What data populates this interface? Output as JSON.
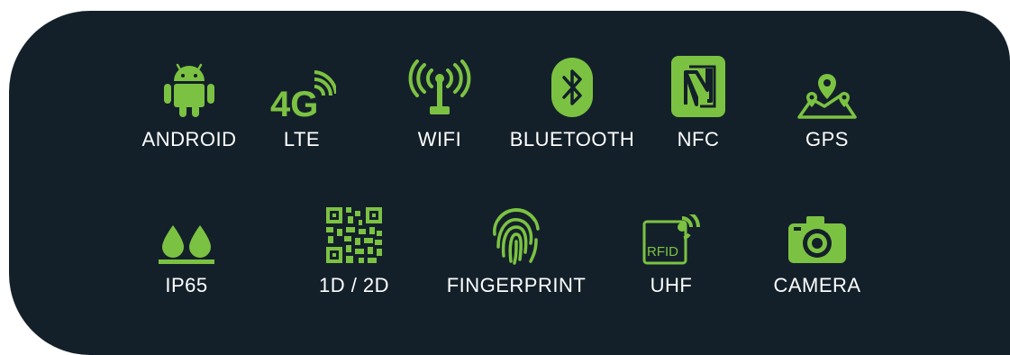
{
  "colors": {
    "background": "#13202a",
    "icon": "#7cc242",
    "text": "#ffffff"
  },
  "row1": [
    {
      "label": "ANDROID",
      "icon": "android-icon"
    },
    {
      "label": "LTE",
      "icon": "lte-4g-icon",
      "icon_text": "4G"
    },
    {
      "label": "WIFI",
      "icon": "wifi-antenna-icon"
    },
    {
      "label": "BLUETOOTH",
      "icon": "bluetooth-icon"
    },
    {
      "label": "NFC",
      "icon": "nfc-icon"
    },
    {
      "label": "GPS",
      "icon": "gps-map-icon"
    }
  ],
  "row2": [
    {
      "label": "IP65",
      "icon": "water-drops-icon"
    },
    {
      "label": "1D / 2D",
      "icon": "qr-code-icon"
    },
    {
      "label": "FINGERPRINT",
      "icon": "fingerprint-icon"
    },
    {
      "label": "UHF",
      "icon": "rfid-icon",
      "icon_text": "RFID"
    },
    {
      "label": "CAMERA",
      "icon": "camera-icon"
    }
  ]
}
